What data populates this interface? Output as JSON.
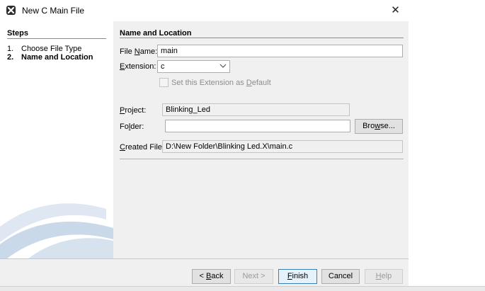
{
  "window": {
    "title": "New C Main File",
    "close_glyph": "✕"
  },
  "steps": {
    "title": "Steps",
    "items": [
      {
        "num": "1.",
        "label": "Choose File Type"
      },
      {
        "num": "2.",
        "label": "Name and Location"
      }
    ]
  },
  "content": {
    "title": "Name and Location",
    "file_name": {
      "label_pre": "File ",
      "label_key": "N",
      "label_post": "ame:",
      "value": "main"
    },
    "extension": {
      "label_pre": "",
      "label_key": "E",
      "label_post": "xtension:",
      "value": "c"
    },
    "set_default": {
      "label_pre": "Set this Extension as ",
      "label_key": "D",
      "label_post": "efault",
      "checked": false
    },
    "project": {
      "label_pre": "",
      "label_key": "P",
      "label_post": "roject:",
      "value": "Blinking_Led"
    },
    "folder": {
      "label_pre": "Fo",
      "label_key": "l",
      "label_post": "der:",
      "value": ""
    },
    "browse": {
      "label_pre": "Bro",
      "label_key": "w",
      "label_post": "se..."
    },
    "created_file": {
      "label_pre": "",
      "label_key": "C",
      "label_post": "reated File:",
      "value": "D:\\New Folder\\Blinking Led.X\\main.c"
    }
  },
  "buttons": {
    "back": {
      "pre": "< ",
      "key": "B",
      "post": "ack"
    },
    "next": {
      "label": "Next >"
    },
    "finish": {
      "pre": "",
      "key": "F",
      "post": "inish"
    },
    "cancel": {
      "label": "Cancel"
    },
    "help": {
      "pre": "",
      "key": "H",
      "post": "elp"
    }
  },
  "icons": {
    "app": "mplab-icon",
    "close": "close-icon",
    "chevron": "chevron-down-icon"
  },
  "colors": {
    "dialog_bg": "#f0f0f0",
    "primary_border": "#3c7fb1",
    "swoosh": "#c9d9ea"
  }
}
